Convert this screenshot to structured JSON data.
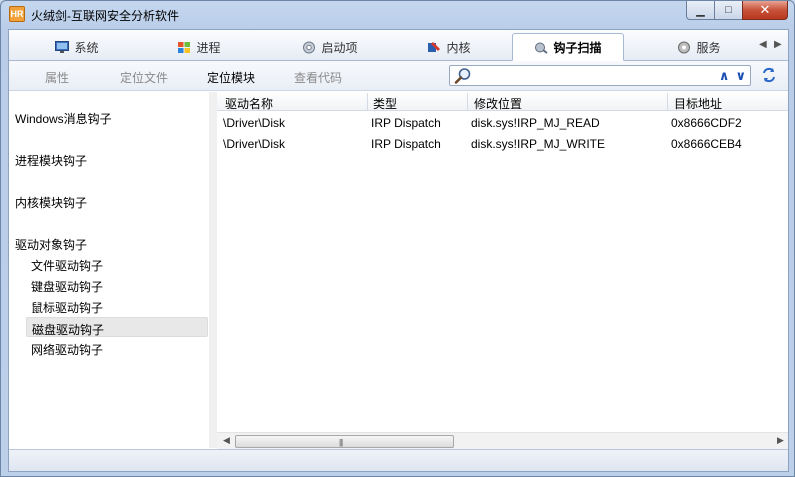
{
  "window": {
    "title": "火绒剑-互联网安全分析软件",
    "icon_text": "HR",
    "minimize_glyph": "▁",
    "maximize_glyph": "□",
    "close_glyph": "✕"
  },
  "tabs": [
    {
      "label": "系统",
      "icon": "system-monitor-icon",
      "active": false
    },
    {
      "label": "进程",
      "icon": "windows-logo-icon",
      "active": false
    },
    {
      "label": "启动项",
      "icon": "gear-startup-icon",
      "active": false
    },
    {
      "label": "内核",
      "icon": "kernel-icon",
      "active": false
    },
    {
      "label": "钩子扫描",
      "icon": "hook-scan-icon",
      "active": true
    },
    {
      "label": "服务",
      "icon": "service-gear-icon",
      "active": false
    }
  ],
  "tab_scroll": {
    "left": "◀",
    "right": "▶"
  },
  "toolbar": {
    "properties": "属性",
    "locate_file": "定位文件",
    "locate_module": "定位模块",
    "view_code": "查看代码"
  },
  "search": {
    "value": "",
    "placeholder": "",
    "up_glyph": "∧",
    "down_glyph": "∨"
  },
  "tree": {
    "items": [
      {
        "label": "Windows消息钩子",
        "level": 0
      },
      {
        "label": "进程模块钩子",
        "level": 0
      },
      {
        "label": "内核模块钩子",
        "level": 0
      },
      {
        "label": "驱动对象钩子",
        "level": 0
      },
      {
        "label": "文件驱动钩子",
        "level": 1
      },
      {
        "label": "键盘驱动钩子",
        "level": 1
      },
      {
        "label": "鼠标驱动钩子",
        "level": 1
      },
      {
        "label": "磁盘驱动钩子",
        "level": 1,
        "selected": true
      },
      {
        "label": "网络驱动钩子",
        "level": 1
      }
    ]
  },
  "table": {
    "columns": [
      "驱动名称",
      "类型",
      "修改位置",
      "目标地址"
    ],
    "rows": [
      [
        "\\Driver\\Disk",
        "IRP Dispatch",
        "disk.sys!IRP_MJ_READ",
        "0x8666CDF2"
      ],
      [
        "\\Driver\\Disk",
        "IRP Dispatch",
        "disk.sys!IRP_MJ_WRITE",
        "0x8666CEB4"
      ]
    ]
  },
  "hscroll": {
    "left": "◀",
    "right": "▶",
    "grip": "|||"
  },
  "colors": {
    "accent": "#1a4fb3",
    "selection": "#e8e8e8",
    "frame": "#b9cde9"
  }
}
